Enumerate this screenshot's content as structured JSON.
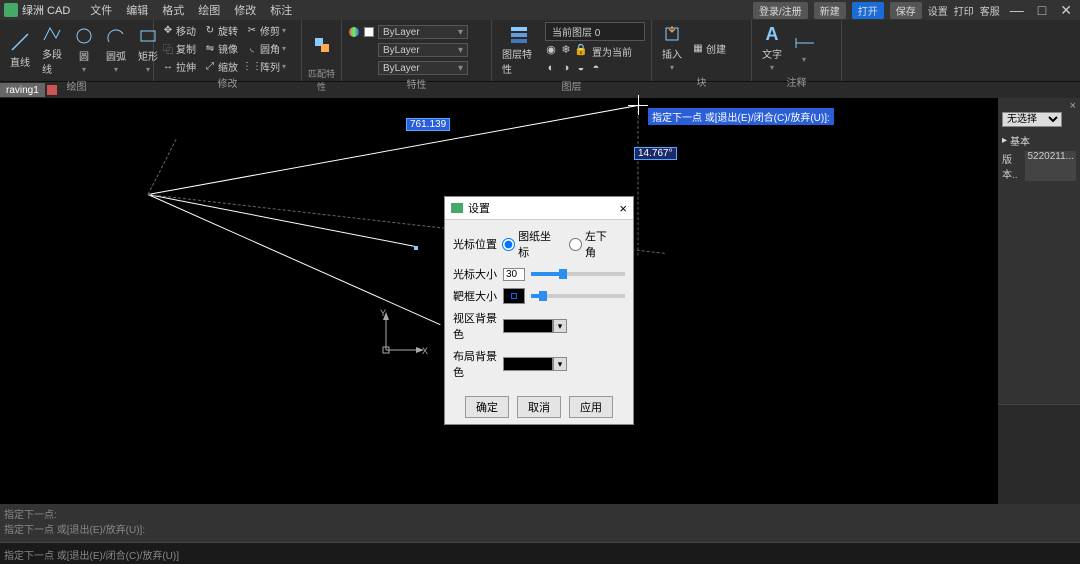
{
  "app": {
    "title": "绿洲 CAD"
  },
  "menu": [
    "文件",
    "编辑",
    "格式",
    "绘图",
    "修改",
    "标注"
  ],
  "title_buttons": {
    "login": "登录/注册",
    "new": "新建",
    "open": "打开",
    "save": "保存",
    "settings": "设置",
    "print": "打印",
    "service": "客服"
  },
  "ribbon": {
    "draw": {
      "label": "绘图",
      "line": "直线",
      "poly": "多段线",
      "circle": "圆",
      "arc": "圆弧",
      "rect": "矩形"
    },
    "modify": {
      "label": "修改",
      "move": "移动",
      "rotate": "旋转",
      "trim": "修剪",
      "copy": "复制",
      "mirror": "镜像",
      "fillet": "圆角",
      "stretch": "拉伸",
      "scale": "缩放",
      "array": "阵列"
    },
    "match": {
      "label": "匹配特性"
    },
    "props": {
      "label": "特性",
      "bylayer": "ByLayer"
    },
    "layer": {
      "label": "图层",
      "props": "图层特性",
      "current": "当前图层 0",
      "set": "置为当前"
    },
    "block": {
      "label": "块",
      "insert": "插入",
      "create": "创建"
    },
    "text": {
      "label": "注释",
      "text": "文字"
    }
  },
  "tab": {
    "name": "raving1"
  },
  "canvas": {
    "dim1": "761.139",
    "dim2": "14.767°",
    "tip": "指定下一点 或[退出(E)/闭合(C)/放弃(U)]:",
    "axis_x": "X",
    "axis_y": "Y"
  },
  "dialog": {
    "title": "设置",
    "cursor_pos": "光标位置",
    "opt_paper": "图纸坐标",
    "opt_corner": "左下角",
    "cursor_size": "光标大小",
    "cursor_size_val": "30",
    "box_size": "靶框大小",
    "view_bg": "视区背景色",
    "layout_bg": "布局背景色",
    "ok": "确定",
    "cancel": "取消",
    "apply": "应用"
  },
  "props": {
    "none": "无选择",
    "basic": "基本",
    "version_k": "版本..",
    "version_v": "5220211..."
  },
  "cmd": {
    "l1": "指定下一点:",
    "l2": "指定下一点 或[退出(E)/放弃(U)]:",
    "input": "指定下一点 或[退出(E)/闭合(C)/放弃(U)]"
  }
}
